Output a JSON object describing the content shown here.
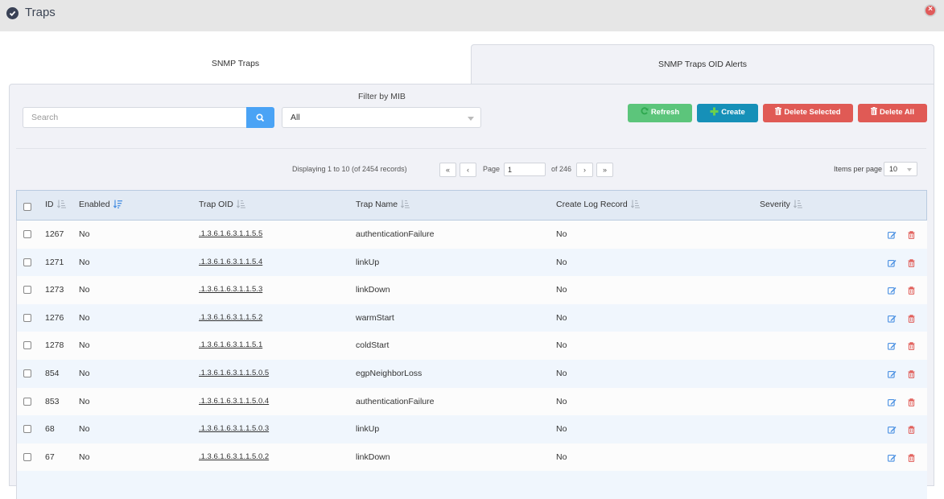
{
  "window": {
    "title": "Traps"
  },
  "tabs": [
    {
      "label": "SNMP Traps",
      "active": false
    },
    {
      "label": "SNMP Traps OID Alerts",
      "active": true
    }
  ],
  "toolbar": {
    "search_placeholder": "Search",
    "search_value": "",
    "filter_label": "Filter by MIB",
    "filter_value": "All",
    "refresh_label": "Refresh",
    "create_label": "Create",
    "delete_selected_label": "Delete Selected",
    "delete_all_label": "Delete All"
  },
  "pagination": {
    "displaying": "Displaying 1 to 10 (of 2454 records)",
    "first": "«",
    "prev": "‹",
    "page_label": "Page",
    "page_value": "1",
    "of_label": "of 246",
    "next": "›",
    "last": "»",
    "items_per_page_label": "Items per page",
    "items_per_page_value": "10"
  },
  "table": {
    "columns": [
      {
        "key": "id",
        "label": "ID",
        "sort_active": false
      },
      {
        "key": "enabled",
        "label": "Enabled",
        "sort_active": true
      },
      {
        "key": "trap_oid",
        "label": "Trap OID",
        "sort_active": false
      },
      {
        "key": "trap_name",
        "label": "Trap Name",
        "sort_active": false
      },
      {
        "key": "create_log_record",
        "label": "Create Log Record",
        "sort_active": false
      },
      {
        "key": "severity",
        "label": "Severity",
        "sort_active": false
      }
    ],
    "rows": [
      {
        "id": "1267",
        "enabled": "No",
        "trap_oid": ".1.3.6.1.6.3.1.1.5.5",
        "trap_name": "authenticationFailure",
        "create_log_record": "No",
        "severity": ""
      },
      {
        "id": "1271",
        "enabled": "No",
        "trap_oid": ".1.3.6.1.6.3.1.1.5.4",
        "trap_name": "linkUp",
        "create_log_record": "No",
        "severity": ""
      },
      {
        "id": "1273",
        "enabled": "No",
        "trap_oid": ".1.3.6.1.6.3.1.1.5.3",
        "trap_name": "linkDown",
        "create_log_record": "No",
        "severity": ""
      },
      {
        "id": "1276",
        "enabled": "No",
        "trap_oid": ".1.3.6.1.6.3.1.1.5.2",
        "trap_name": "warmStart",
        "create_log_record": "No",
        "severity": ""
      },
      {
        "id": "1278",
        "enabled": "No",
        "trap_oid": ".1.3.6.1.6.3.1.1.5.1",
        "trap_name": "coldStart",
        "create_log_record": "No",
        "severity": ""
      },
      {
        "id": "854",
        "enabled": "No",
        "trap_oid": ".1.3.6.1.6.3.1.1.5.0.5",
        "trap_name": "egpNeighborLoss",
        "create_log_record": "No",
        "severity": ""
      },
      {
        "id": "853",
        "enabled": "No",
        "trap_oid": ".1.3.6.1.6.3.1.1.5.0.4",
        "trap_name": "authenticationFailure",
        "create_log_record": "No",
        "severity": ""
      },
      {
        "id": "68",
        "enabled": "No",
        "trap_oid": ".1.3.6.1.6.3.1.1.5.0.3",
        "trap_name": "linkUp",
        "create_log_record": "No",
        "severity": ""
      },
      {
        "id": "67",
        "enabled": "No",
        "trap_oid": ".1.3.6.1.6.3.1.1.5.0.2",
        "trap_name": "linkDown",
        "create_log_record": "No",
        "severity": ""
      }
    ]
  },
  "colors": {
    "refresh": "#5cc57b",
    "create": "#1690b8",
    "delete": "#e05a55",
    "search_button": "#4aa3f5",
    "header_bg": "#e2eaf4",
    "edit_icon": "#4a90e2",
    "delete_icon": "#e05a55"
  }
}
